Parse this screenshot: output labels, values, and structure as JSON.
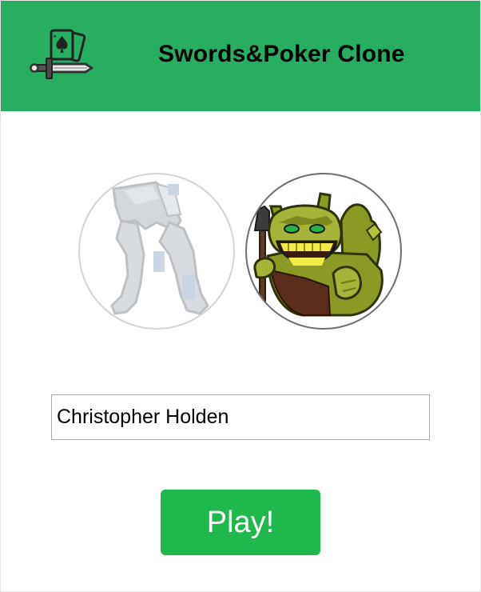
{
  "header": {
    "title": "Swords&Poker Clone",
    "logo_icon": "sword-and-cards-icon",
    "background_color": "#27ae60"
  },
  "characters": [
    {
      "name": "knight",
      "icon": "knight-avatar",
      "selected": false
    },
    {
      "name": "ogre",
      "icon": "ogre-avatar",
      "selected": true
    }
  ],
  "player_name_input": {
    "value": "Christopher Holden"
  },
  "play_button": {
    "label": "Play!",
    "color": "#1fb84d"
  }
}
